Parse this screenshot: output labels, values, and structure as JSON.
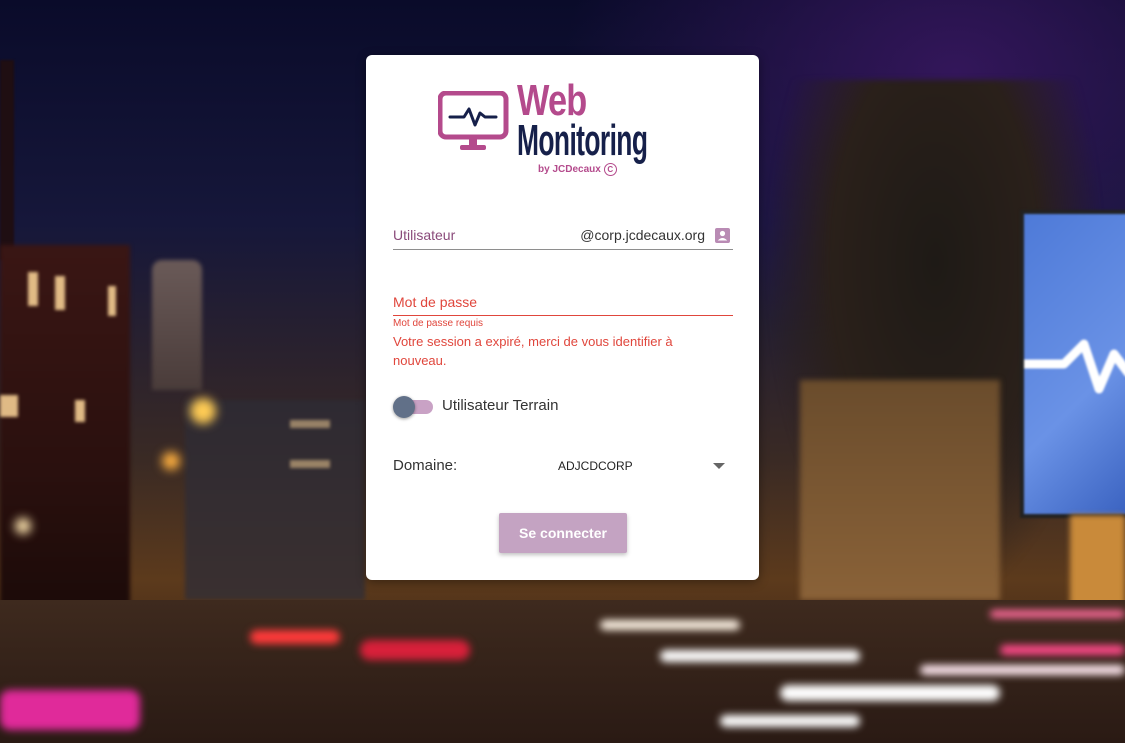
{
  "logo": {
    "title_line1": "Web",
    "title_line2": "Monitoring",
    "byline": "by JCDecaux",
    "copyright_symbol": "C",
    "icon": "monitor-pulse-icon",
    "primary_color": "#b44a8c",
    "secondary_color": "#16204a"
  },
  "login": {
    "username_label": "Utilisateur",
    "username_suffix": "@corp.jcdecaux.org",
    "username_icon": "account-box-icon",
    "password_label": "Mot de passe",
    "password_hint": "Mot de passe requis",
    "error_message": "Votre session a expiré, merci de vous identifier à nouveau.",
    "field_user_toggle_label": "Utilisateur Terrain",
    "domain_label": "Domaine:",
    "domain_value": "ADJCDCORP",
    "submit_label": "Se connecter",
    "error_color": "#e0463c",
    "accent_color": "#c4a3c2"
  }
}
